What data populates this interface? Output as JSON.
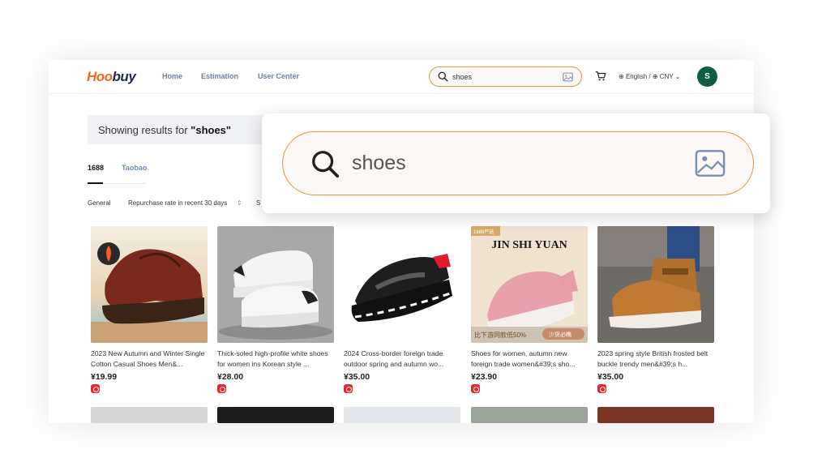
{
  "header": {
    "logo_part1": "Hoo",
    "logo_part2": "buy",
    "nav": [
      "Home",
      "Estimation",
      "User Center"
    ],
    "search_value": "shoes",
    "locale": "English / ⊕ CNY",
    "avatar_initial": "S"
  },
  "results": {
    "prefix": "Showing results for ",
    "query": "\"shoes\""
  },
  "tabs": [
    "1688",
    "Taobao"
  ],
  "filters": {
    "general": "General",
    "repurchase": "Repurchase rate in recent 30 days",
    "sort_icon": "⇕",
    "next": "S"
  },
  "products": [
    {
      "title": "2023 New Autumn and Winter Single Cotton Casual Shoes Men&...",
      "price": "¥19.99"
    },
    {
      "title": "Thick-soled high-profile white shoes for women ins Korean style ...",
      "price": "¥28.00"
    },
    {
      "title": "2024 Cross-border foreign trade outdoor spring and autumn wo...",
      "price": "¥35.00"
    },
    {
      "title": "Shoes for women, autumn new foreign trade women&#39;s sho...",
      "price": "¥23.90",
      "overlay_brand": "JIN SHI YUAN",
      "overlay_tag": "1688严选",
      "overlay_bottom_left": "比下游同款低50%",
      "overlay_bottom_right": "少货必瞧"
    },
    {
      "title": "2023 spring style British frosted belt buckle trendy men&#39;s h...",
      "price": "¥35.00"
    }
  ],
  "zoom": {
    "search_value": "shoes"
  },
  "colors": {
    "accent_orange": "#f26a1b",
    "logo_navy": "#1e2a55",
    "avatar_green": "#0f5d44",
    "badge_red": "#e8262b",
    "search_border": "#f0903e"
  }
}
